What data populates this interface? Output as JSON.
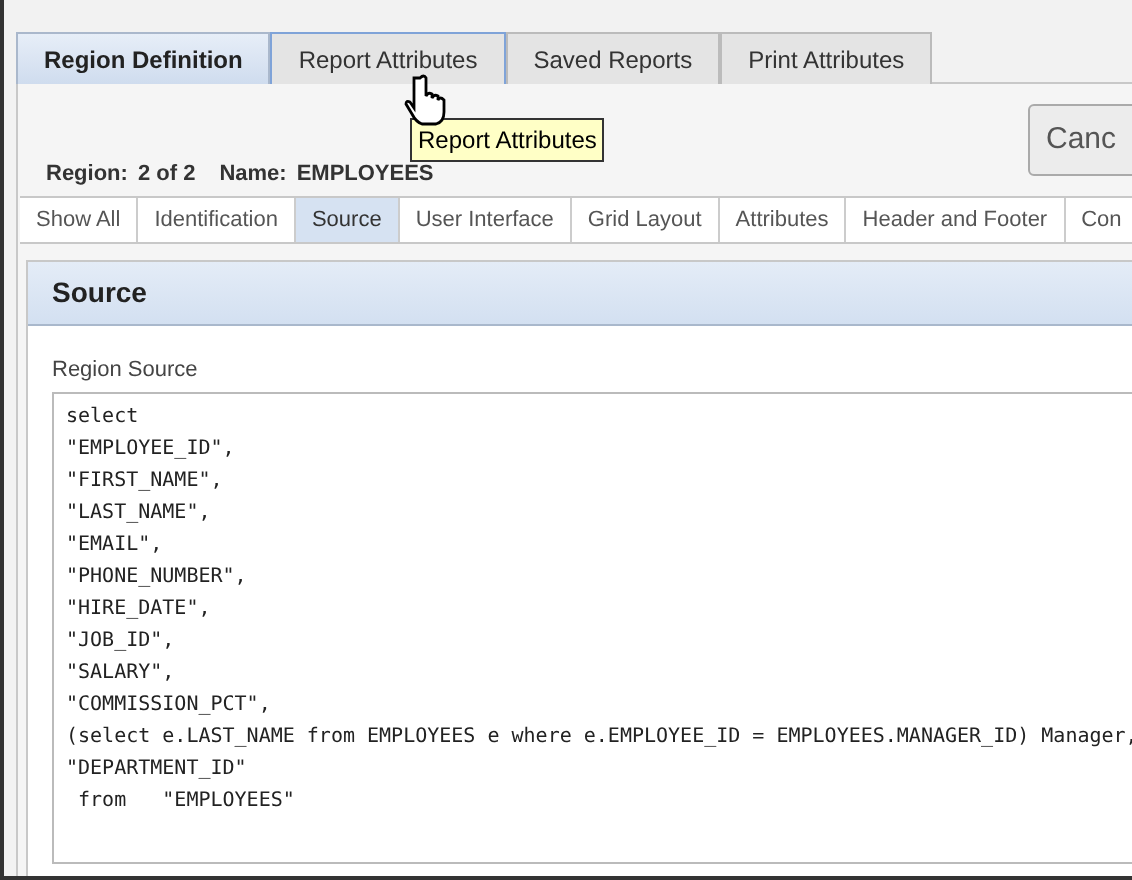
{
  "tabs": [
    {
      "label": "Region Definition",
      "selected": true,
      "hovered": false
    },
    {
      "label": "Report Attributes",
      "selected": false,
      "hovered": true
    },
    {
      "label": "Saved Reports",
      "selected": false,
      "hovered": false
    },
    {
      "label": "Print Attributes",
      "selected": false,
      "hovered": false
    }
  ],
  "tooltip": "Report Attributes",
  "cancel_button": "Canc",
  "region_info": {
    "region_label": "Region:",
    "region_value": "2 of 2",
    "name_label": "Name:",
    "name_value": "EMPLOYEES"
  },
  "subtabs": [
    {
      "label": "Show All",
      "selected": false
    },
    {
      "label": "Identification",
      "selected": false
    },
    {
      "label": "Source",
      "selected": true
    },
    {
      "label": "User Interface",
      "selected": false
    },
    {
      "label": "Grid Layout",
      "selected": false
    },
    {
      "label": "Attributes",
      "selected": false
    },
    {
      "label": "Header and Footer",
      "selected": false
    },
    {
      "label": "Con",
      "selected": false
    }
  ],
  "section_title": "Source",
  "field_label": "Region Source",
  "code_lines": [
    "select",
    "\"EMPLOYEE_ID\",",
    "\"FIRST_NAME\",",
    "\"LAST_NAME\",",
    "\"EMAIL\",",
    "\"PHONE_NUMBER\",",
    "\"HIRE_DATE\",",
    "\"JOB_ID\",",
    "\"SALARY\",",
    "\"COMMISSION_PCT\",",
    "(select e.LAST_NAME from EMPLOYEES e where e.EMPLOYEE_ID = EMPLOYEES.MANAGER_ID) Manager,",
    "\"DEPARTMENT_ID\"",
    " from   \"EMPLOYEES\""
  ]
}
